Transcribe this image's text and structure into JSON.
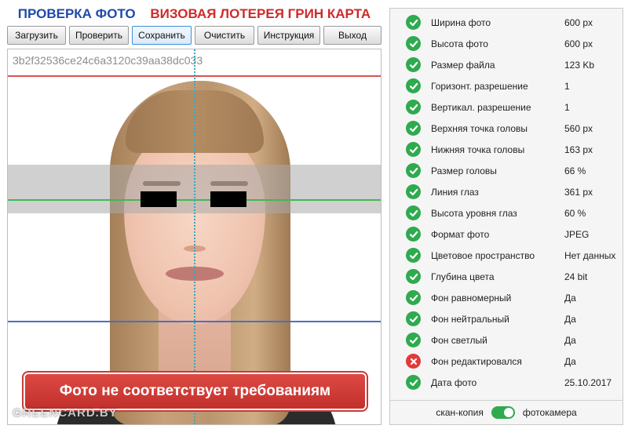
{
  "header": {
    "title_left": "ПРОВЕРКА ФОТО",
    "title_right": "ВИЗОВАЯ ЛОТЕРЕЯ ГРИН КАРТА",
    "title_left_color": "#1f4aa8",
    "title_right_color": "#cf2a2a"
  },
  "toolbar": {
    "buttons": [
      {
        "label": "Загрузить"
      },
      {
        "label": "Проверить"
      },
      {
        "label": "Сохранить",
        "active": true
      },
      {
        "label": "Очистить"
      },
      {
        "label": "Инструкция"
      },
      {
        "label": "Выход"
      }
    ]
  },
  "photo": {
    "hash": "3b2f32536ce24c6a3120c39aa38dc033",
    "warning": "Фото не соответствует требованиям",
    "watermark": "GREENCARD.BY",
    "guide_colors": {
      "top": "#d9534f",
      "eyes": "#3dba52",
      "chin": "#4a6fc4",
      "center": "#3aa6c0"
    }
  },
  "results": {
    "items": [
      {
        "label": "Ширина фото",
        "value": "600 px",
        "status": "ok"
      },
      {
        "label": "Высота фото",
        "value": "600 px",
        "status": "ok"
      },
      {
        "label": "Размер файла",
        "value": "123 Kb",
        "status": "ok"
      },
      {
        "label": "Горизонт. разрешение",
        "value": "1",
        "status": "ok"
      },
      {
        "label": "Вертикал. разрешение",
        "value": "1",
        "status": "ok"
      },
      {
        "label": "Верхняя точка головы",
        "value": "560 px",
        "status": "ok"
      },
      {
        "label": "Нижняя точка головы",
        "value": "163 px",
        "status": "ok"
      },
      {
        "label": "Размер головы",
        "value": "66 %",
        "status": "ok"
      },
      {
        "label": "Линия глаз",
        "value": "361 px",
        "status": "ok"
      },
      {
        "label": "Высота уровня глаз",
        "value": "60 %",
        "status": "ok"
      },
      {
        "label": "Формат фото",
        "value": "JPEG",
        "status": "ok"
      },
      {
        "label": "Цветовое пространство",
        "value": "Нет данных",
        "status": "ok"
      },
      {
        "label": "Глубина цвета",
        "value": "24 bit",
        "status": "ok"
      },
      {
        "label": "Фон равномерный",
        "value": "Да",
        "status": "ok"
      },
      {
        "label": "Фон нейтральный",
        "value": "Да",
        "status": "ok"
      },
      {
        "label": "Фон светлый",
        "value": "Да",
        "status": "ok"
      },
      {
        "label": "Фон редактировался",
        "value": "Да",
        "status": "error"
      },
      {
        "label": "Дата фото",
        "value": "25.10.2017",
        "status": "ok"
      }
    ],
    "status_colors": {
      "ok": "#2faa4f",
      "error": "#e03a3a"
    },
    "toggle": {
      "left_label": "скан-копия",
      "right_label": "фотокамера",
      "state": "on"
    }
  }
}
